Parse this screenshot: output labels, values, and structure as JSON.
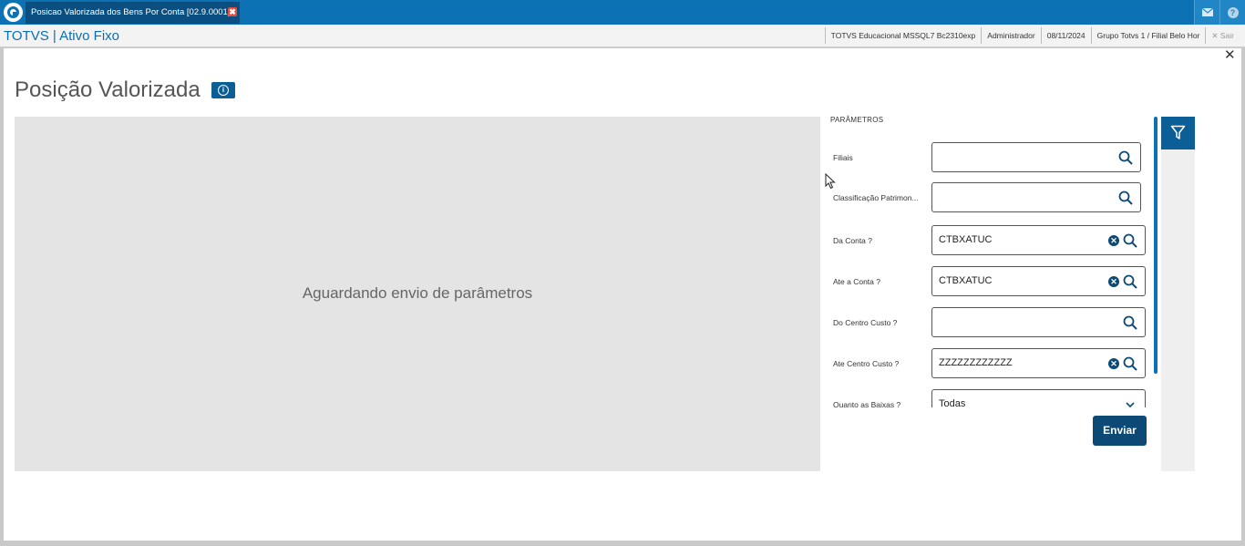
{
  "topbar": {
    "tab_title": "Posicao Valorizada dos Bens Por Conta [02.9.0001]",
    "tab_close": "✖",
    "mail_icon": "mail-icon",
    "help_label": "?"
  },
  "header": {
    "app_title": "TOTVS | Ativo Fixo",
    "environment": "TOTVS Educacional MSSQL7 Bc2310exp",
    "user": "Administrador",
    "date": "08/11/2024",
    "branch": "Grupo Totvs 1 / Filial Belo Hor",
    "exit_label": "✕  Sair"
  },
  "page": {
    "title": "Posição Valorizada",
    "info_label": "i",
    "close_label": "✕",
    "preview_message": "Aguardando envio de parâmetros"
  },
  "parameters": {
    "section_title": "PARÂMETROS",
    "fields": [
      {
        "label": "Filiais",
        "value": ""
      },
      {
        "label": "Classificação Patrimon...",
        "value": ""
      },
      {
        "label": "Da Conta ?",
        "value": "CTBXATUC"
      },
      {
        "label": "Ate a Conta ?",
        "value": "CTBXATUC"
      },
      {
        "label": "Do Centro Custo ?",
        "value": ""
      },
      {
        "label": "Ate Centro Custo ?",
        "value": "ZZZZZZZZZZZZ"
      },
      {
        "label": "Quanto as Baixas ?",
        "value": "Todas"
      }
    ],
    "clear_label": "✕",
    "send_label": "Enviar"
  },
  "colors": {
    "brand_blue": "#0c72b3",
    "dark_blue": "#0c4a75",
    "tab_bg": "#0a4f80"
  }
}
